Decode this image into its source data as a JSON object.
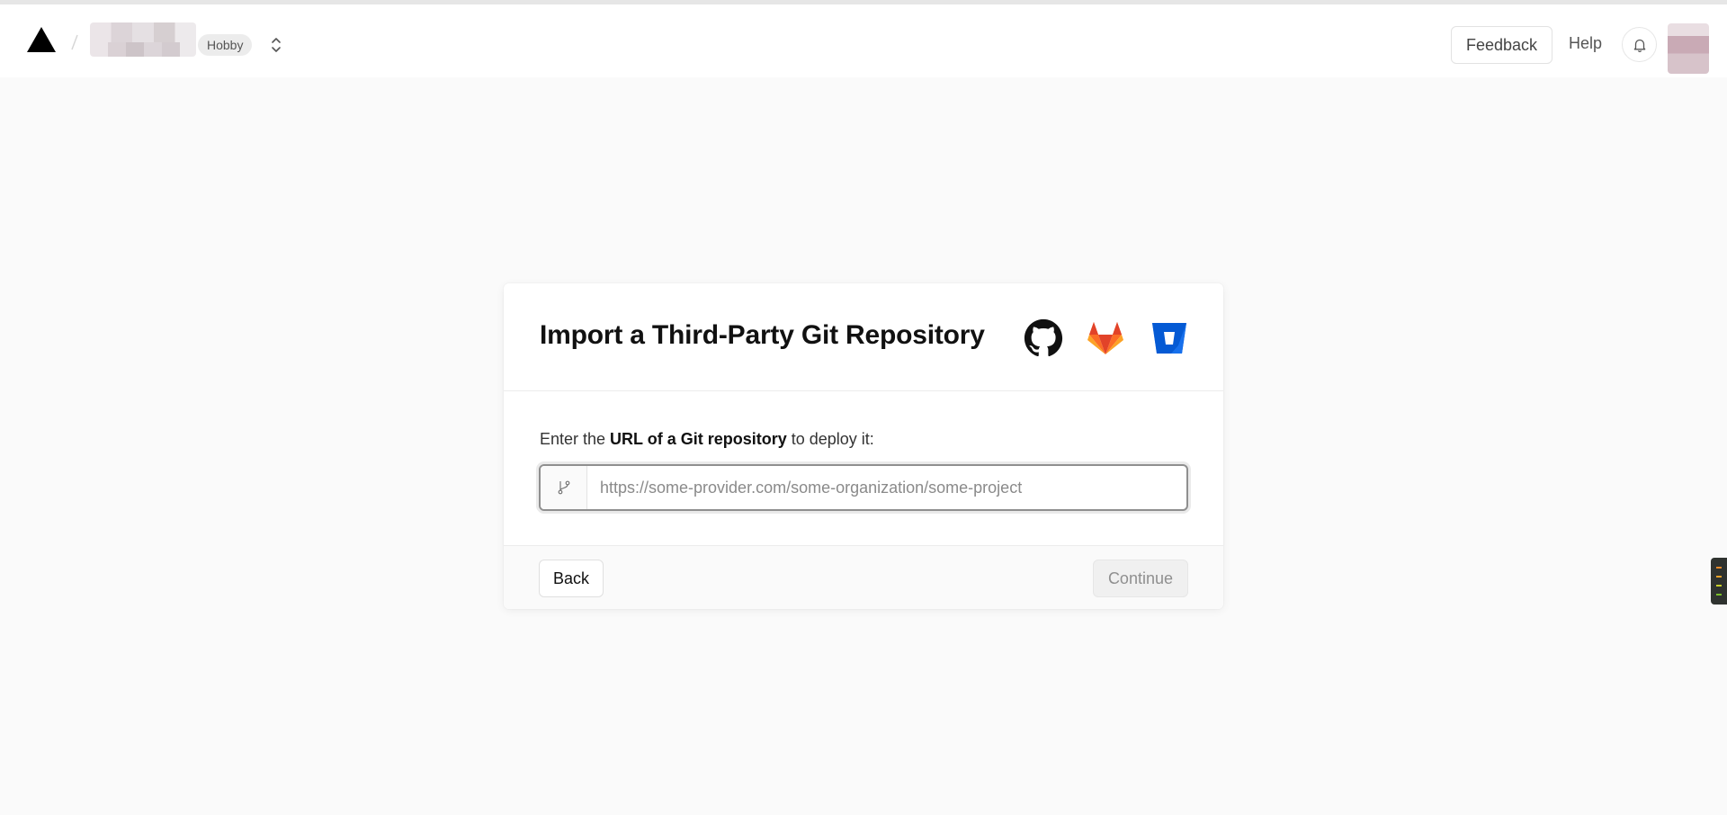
{
  "header": {
    "plan_badge": "Hobby",
    "feedback_label": "Feedback",
    "help_label": "Help"
  },
  "card": {
    "title": "Import a Third-Party Git Repository",
    "providers": [
      "github-icon",
      "gitlab-icon",
      "bitbucket-icon"
    ],
    "prompt_prefix": "Enter the ",
    "prompt_bold": "URL of a Git repository",
    "prompt_suffix": " to deploy it:",
    "url_input": {
      "value": "",
      "placeholder": "https://some-provider.com/some-organization/some-project"
    },
    "back_label": "Back",
    "continue_label": "Continue"
  },
  "colors": {
    "page_bg": "#fafafa",
    "gitlab_orange": "#fc6d26",
    "bitbucket_blue": "#0052cc"
  }
}
